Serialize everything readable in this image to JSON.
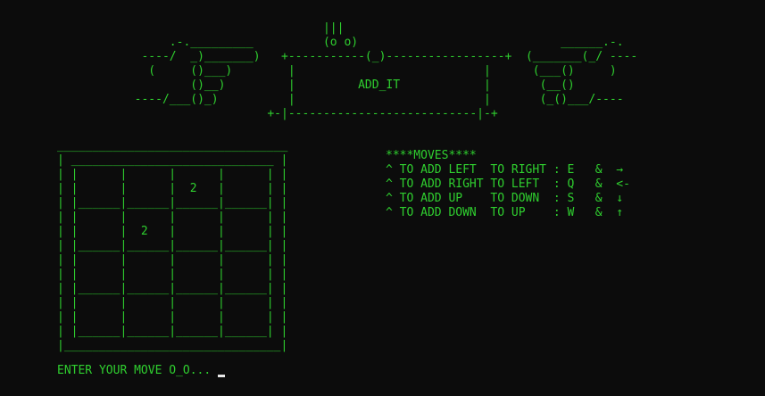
{
  "header": {
    "art_lines": [
      "                             |||",
      "       .-._________          (o o)                             ______.-.",
      "   ----/  _)_______)   +-----------(_)-----------------+  (_______(_/ ----",
      "    (     ()___)        |                           |      (___()     )",
      "          ()__)         |         ADD_IT            |       (__()",
      "  ----/___()_)          |                           |       (_()___/----",
      "                     +-|---------------------------|-+"
    ]
  },
  "board": {
    "rows": 4,
    "cols": 4,
    "cells": [
      [
        "",
        "",
        "2",
        ""
      ],
      [
        "",
        "2",
        "",
        ""
      ],
      [
        "",
        "",
        "",
        ""
      ],
      [
        "",
        "",
        "",
        ""
      ]
    ]
  },
  "moves": {
    "title": "****MOVES****",
    "items": [
      "^ TO ADD LEFT  TO RIGHT : E   &  →",
      "^ TO ADD RIGHT TO LEFT  : Q   &  <-",
      "^ TO ADD UP    TO DOWN  : S   &  ↓",
      "^ TO ADD DOWN  TO UP    : W   &  ↑"
    ]
  },
  "prompt": {
    "text": "ENTER YOUR MOVE O_O..."
  },
  "colors": {
    "background": "#0c0c0c",
    "text": "#2fcf2f",
    "cursor": "#e8e8e8"
  }
}
